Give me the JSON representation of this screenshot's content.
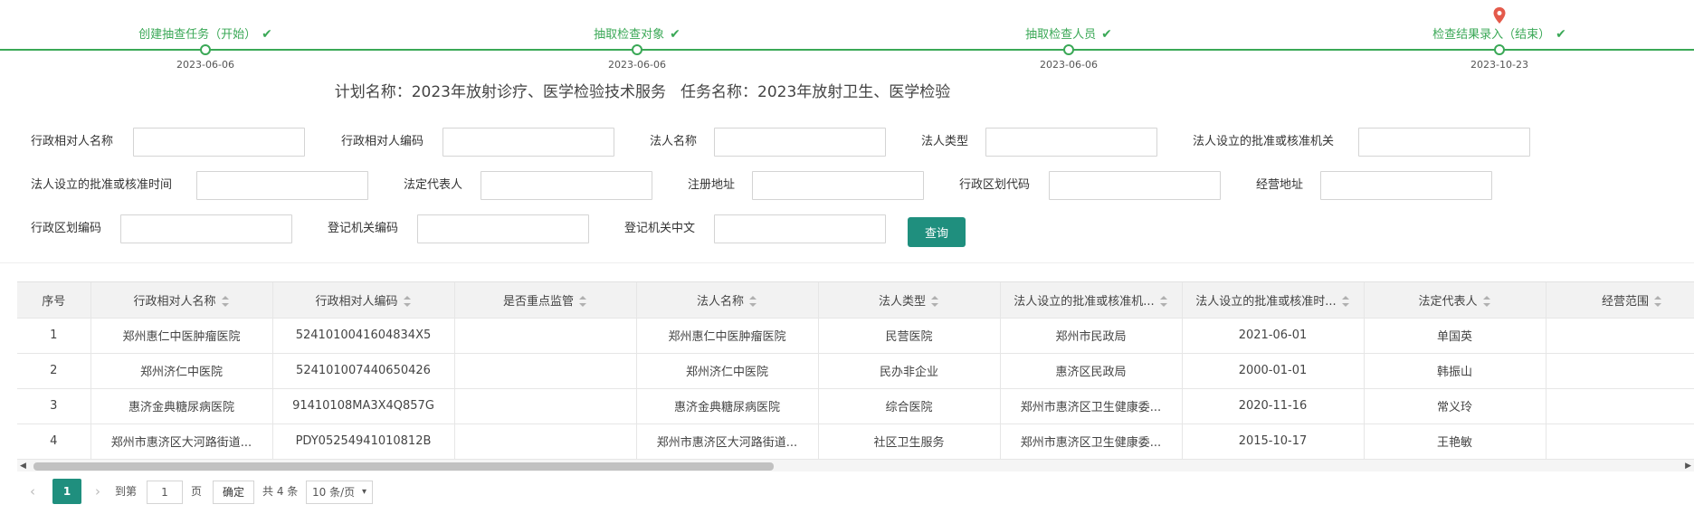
{
  "steps": [
    {
      "label": "创建抽查任务（开始）",
      "date": "2023-06-06"
    },
    {
      "label": "抽取检查对象",
      "date": "2023-06-06"
    },
    {
      "label": "抽取检查人员",
      "date": "2023-06-06"
    },
    {
      "label": "检查结果录入（结束）",
      "date": "2023-10-23"
    }
  ],
  "plan": {
    "plan_label": "计划名称：",
    "plan_name": "2023年放射诊疗、医学检验技术服务",
    "task_label": "任务名称：",
    "task_name": "2023年放射卫生、医学检验"
  },
  "form": {
    "f1": "行政相对人名称",
    "f2": "行政相对人编码",
    "f3": "法人名称",
    "f4": "法人类型",
    "f5": "法人设立的批准或核准机关",
    "f6": "法人设立的批准或核准时间",
    "f7": "法定代表人",
    "f8": "注册地址",
    "f9": "行政区划代码",
    "f10": "经营地址",
    "f11": "行政区划编码",
    "f12": "登记机关编码",
    "f13": "登记机关中文",
    "search_label": "查询"
  },
  "table": {
    "headers": [
      "序号",
      "行政相对人名称",
      "行政相对人编码",
      "是否重点监管",
      "法人名称",
      "法人类型",
      "法人设立的批准或核准机...",
      "法人设立的批准或核准时...",
      "法定代表人",
      "经营范围"
    ],
    "rows": [
      [
        "1",
        "郑州惠仁中医肿瘤医院",
        "5241010041604834X5",
        "",
        "郑州惠仁中医肿瘤医院",
        "民营医院",
        "郑州市民政局",
        "2021-06-01",
        "单国英",
        ""
      ],
      [
        "2",
        "郑州济仁中医院",
        "524101007440650426",
        "",
        "郑州济仁中医院",
        "民办非企业",
        "惠济区民政局",
        "2000-01-01",
        "韩振山",
        ""
      ],
      [
        "3",
        "惠济金典糖尿病医院",
        "91410108MA3X4Q857G",
        "",
        "惠济金典糖尿病医院",
        "综合医院",
        "郑州市惠济区卫生健康委...",
        "2020-11-16",
        "常义玲",
        ""
      ],
      [
        "4",
        "郑州市惠济区大河路街道...",
        "PDY05254941010812B",
        "",
        "郑州市惠济区大河路街道...",
        "社区卫生服务",
        "郑州市惠济区卫生健康委...",
        "2015-10-17",
        "王艳敏",
        ""
      ]
    ]
  },
  "pager": {
    "current": "1",
    "goto_label": "到第",
    "page_input": "1",
    "page_unit": "页",
    "confirm": "确定",
    "total": "共 4 条",
    "page_size": "10 条/页"
  },
  "colors": {
    "accent": "#1f8f7e",
    "step_green": "#3aa856",
    "pin_red": "#e45a4b"
  }
}
